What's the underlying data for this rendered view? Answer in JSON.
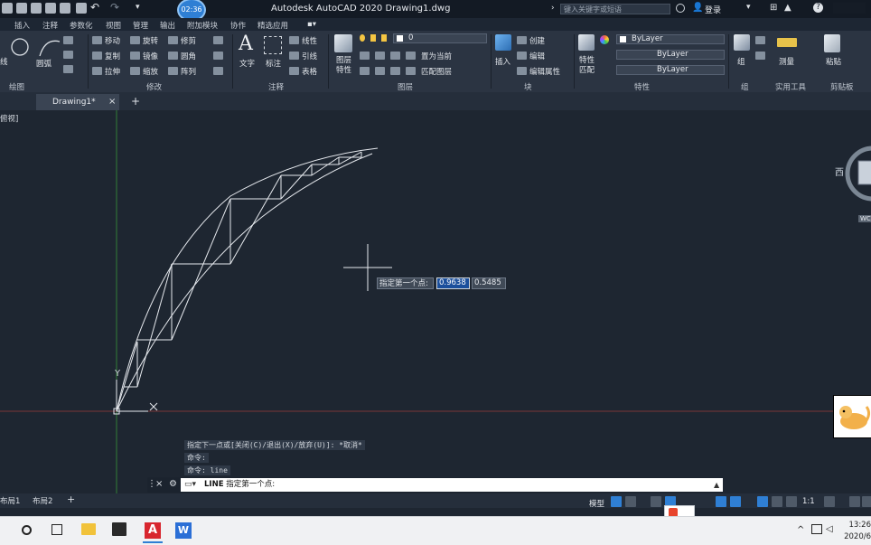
{
  "title_bar": {
    "app_title": "Autodesk AutoCAD 2020    Drawing1.dwg",
    "search_placeholder": "键入关键字或短语",
    "login_label": "登录",
    "clock_badge": "02:36"
  },
  "ribbon_tabs": [
    "插入",
    "注释",
    "参数化",
    "视图",
    "管理",
    "输出",
    "附加模块",
    "协作",
    "精选应用"
  ],
  "ribbon": {
    "draw": {
      "title": "绘图",
      "labels": [
        "线",
        "圆",
        "圆弧"
      ]
    },
    "modify": {
      "title": "修改",
      "buttons": [
        "移动",
        "旋转",
        "修剪",
        "复制",
        "镜像",
        "圆角",
        "拉伸",
        "缩放",
        "阵列"
      ]
    },
    "annotation": {
      "title": "注释",
      "text_label": "文字",
      "dim_label": "标注",
      "buttons": [
        "线性",
        "引线",
        "表格"
      ]
    },
    "layers": {
      "title": "图层",
      "layer_props": "图层特性",
      "current_layer": "0",
      "buttons": [
        "置为当前",
        "匹配图层"
      ]
    },
    "block": {
      "title": "块",
      "insert_label": "插入",
      "buttons": [
        "创建",
        "编辑",
        "编辑属性"
      ]
    },
    "properties": {
      "title": "特性",
      "match_label": "特性匹配",
      "color": "ByLayer",
      "linetype": "ByLayer",
      "lineweight": "ByLayer"
    },
    "groups": {
      "title": "组",
      "label": "组"
    },
    "utilities": {
      "title": "实用工具",
      "label": "测量"
    },
    "clipboard": {
      "title": "剪贴板",
      "label": "粘贴"
    }
  },
  "doc_tab": {
    "label": "Drawing1*"
  },
  "viewport": {
    "label": "俯视]"
  },
  "compass": {
    "west": "西",
    "wcs": "WCS"
  },
  "ucs": {
    "y_label": "Y"
  },
  "dynamic_input": {
    "prompt": "指定第一个点:",
    "x_value": "0.9638",
    "y_value": "0.5485"
  },
  "command_history": [
    "指定下一点或[关闭(C)/退出(X)/放弃(U)]: *取消*",
    "命令:",
    "命令:  line"
  ],
  "command_line": {
    "command": "LINE",
    "prompt": "指定第一个点:"
  },
  "layout_tabs": [
    "布局1",
    "布局2"
  ],
  "status_bar": {
    "model_label": "模型",
    "scale": "1:1"
  },
  "taskbar": {
    "time": "13:26",
    "date": "2020/6"
  },
  "colors": {
    "accent": "#2f7fd4",
    "canvas": "#1e2631",
    "ribbon": "#2b3442"
  }
}
